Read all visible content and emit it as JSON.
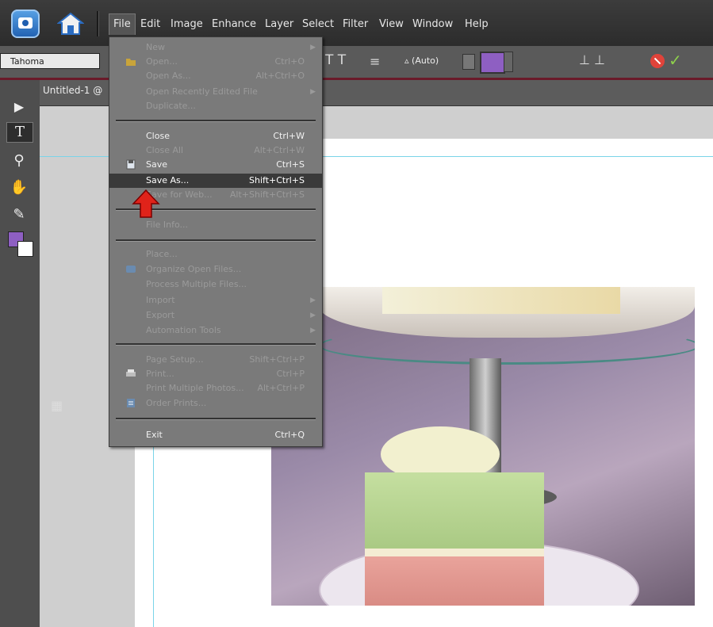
{
  "menubar": {
    "items": [
      "File",
      "Edit",
      "Image",
      "Enhance",
      "Layer",
      "Select",
      "Filter",
      "View",
      "Window",
      "Help"
    ]
  },
  "options": {
    "font": "Tahoma",
    "leading": "(Auto)",
    "swatch_color": "#8e5fc2"
  },
  "document": {
    "tab_title": "Untitled-1 @"
  },
  "file_menu": {
    "items": [
      {
        "label": "New",
        "shortcut": "",
        "enabled": false,
        "submenu": true
      },
      {
        "label": "Open...",
        "shortcut": "Ctrl+O",
        "enabled": false,
        "submenu": false
      },
      {
        "label": "Open As...",
        "shortcut": "Alt+Ctrl+O",
        "enabled": false,
        "submenu": false
      },
      {
        "label": "Open Recently Edited File",
        "shortcut": "",
        "enabled": false,
        "submenu": true
      },
      {
        "label": "Duplicate...",
        "shortcut": "",
        "enabled": false,
        "submenu": false
      },
      {
        "label": "Close",
        "shortcut": "Ctrl+W",
        "enabled": true,
        "submenu": false
      },
      {
        "label": "Close All",
        "shortcut": "Alt+Ctrl+W",
        "enabled": false,
        "submenu": false
      },
      {
        "label": "Save",
        "shortcut": "Ctrl+S",
        "enabled": true,
        "submenu": false
      },
      {
        "label": "Save As...",
        "shortcut": "Shift+Ctrl+S",
        "enabled": true,
        "submenu": false,
        "highlighted": true
      },
      {
        "label": "Save for Web...",
        "shortcut": "Alt+Shift+Ctrl+S",
        "enabled": false,
        "submenu": false
      },
      {
        "label": "File Info...",
        "shortcut": "",
        "enabled": false,
        "submenu": false
      },
      {
        "label": "Place...",
        "shortcut": "",
        "enabled": false,
        "submenu": false
      },
      {
        "label": "Organize Open Files...",
        "shortcut": "",
        "enabled": false,
        "submenu": false
      },
      {
        "label": "Process Multiple Files...",
        "shortcut": "",
        "enabled": false,
        "submenu": false
      },
      {
        "label": "Import",
        "shortcut": "",
        "enabled": false,
        "submenu": true
      },
      {
        "label": "Export",
        "shortcut": "",
        "enabled": false,
        "submenu": true
      },
      {
        "label": "Automation Tools",
        "shortcut": "",
        "enabled": false,
        "submenu": true
      },
      {
        "label": "Page Setup...",
        "shortcut": "Shift+Ctrl+P",
        "enabled": false,
        "submenu": false
      },
      {
        "label": "Print...",
        "shortcut": "Ctrl+P",
        "enabled": false,
        "submenu": false
      },
      {
        "label": "Print Multiple Photos...",
        "shortcut": "Alt+Ctrl+P",
        "enabled": false,
        "submenu": false
      },
      {
        "label": "Order Prints...",
        "shortcut": "",
        "enabled": false,
        "submenu": false
      },
      {
        "label": "Exit",
        "shortcut": "Ctrl+Q",
        "enabled": true,
        "submenu": false
      }
    ]
  },
  "icons": {
    "open": "folder-icon",
    "save": "save-icon",
    "organize": "organize-icon",
    "print": "printer-icon",
    "order_prints": "order-prints-icon"
  },
  "annotation": {
    "arrow_color": "#e0231a"
  }
}
